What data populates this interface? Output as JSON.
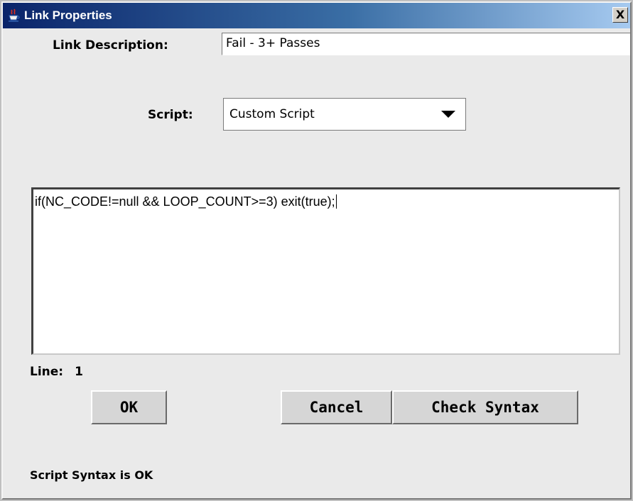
{
  "window": {
    "title": "Link Properties",
    "close_glyph": "X",
    "icon": "java-cup-icon"
  },
  "form": {
    "link_description_label": "Link Description:",
    "link_description_value": "Fail - 3+ Passes",
    "script_label": "Script:",
    "script_selected": "Custom Script"
  },
  "editor": {
    "text": "if(NC_CODE!=null && LOOP_COUNT>=3) exit(true);",
    "line_label": "Line:",
    "line_value": "1"
  },
  "buttons": {
    "ok": "OK",
    "cancel": "Cancel",
    "check_syntax": "Check Syntax"
  },
  "status": {
    "message": "Script Syntax is OK"
  },
  "colors": {
    "title_bar_start": "#0a246a",
    "title_bar_end": "#a6caf0",
    "dialog_background": "#eaeaea"
  }
}
